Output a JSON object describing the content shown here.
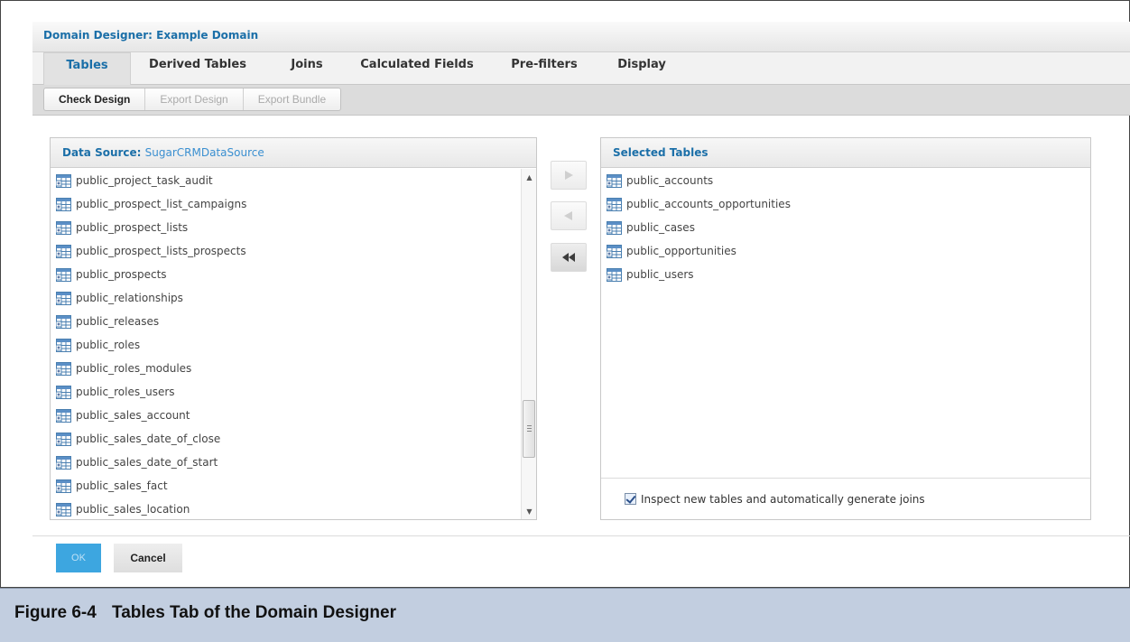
{
  "window": {
    "title": "Domain Designer: Example Domain"
  },
  "tabs": [
    {
      "label": "Tables",
      "active": true
    },
    {
      "label": "Derived Tables",
      "active": false
    },
    {
      "label": "Joins",
      "active": false
    },
    {
      "label": "Calculated Fields",
      "active": false
    },
    {
      "label": "Pre-filters",
      "active": false
    },
    {
      "label": "Display",
      "active": false
    }
  ],
  "toolbar": {
    "check_design": "Check Design",
    "export_design": "Export Design",
    "export_bundle": "Export Bundle"
  },
  "data_source": {
    "label": "Data Source:",
    "value": "SugarCRMDataSource",
    "items": [
      "public_project_task_audit",
      "public_prospect_list_campaigns",
      "public_prospect_lists",
      "public_prospect_lists_prospects",
      "public_prospects",
      "public_relationships",
      "public_releases",
      "public_roles",
      "public_roles_modules",
      "public_roles_users",
      "public_sales_account",
      "public_sales_date_of_close",
      "public_sales_date_of_start",
      "public_sales_fact",
      "public_sales_location"
    ]
  },
  "selected_tables": {
    "title": "Selected Tables",
    "items": [
      "public_accounts",
      "public_accounts_opportunities",
      "public_cases",
      "public_opportunities",
      "public_users"
    ],
    "inspect_label": "Inspect new tables and automatically generate joins",
    "inspect_checked": true
  },
  "buttons": {
    "ok": "OK",
    "cancel": "Cancel"
  },
  "caption": {
    "number": "Figure 6-4",
    "text": "Tables Tab of the Domain Designer"
  },
  "icons": {
    "move_right": "arrow-right-icon",
    "move_left": "arrow-left-icon",
    "move_all_left": "double-arrow-left-icon",
    "table": "table-icon"
  },
  "colors": {
    "accent": "#1b6fa8",
    "ok_button": "#3da6e0",
    "caption_bg": "#c2cee0"
  }
}
